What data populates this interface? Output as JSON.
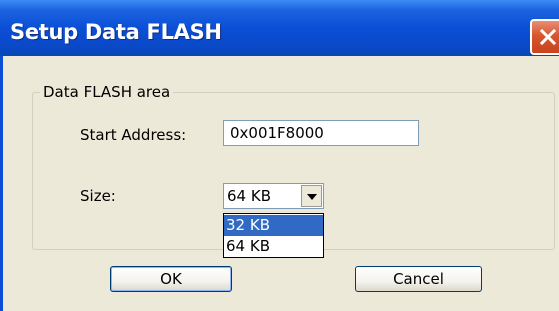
{
  "window": {
    "title": "Setup Data FLASH"
  },
  "group": {
    "label": "Data FLASH area"
  },
  "start_address": {
    "label": "Start Address:",
    "value": "0x001F8000"
  },
  "size": {
    "label": "Size:",
    "selected": "64 KB",
    "options": [
      "32 KB",
      "64 KB"
    ],
    "highlighted": "32 KB"
  },
  "buttons": {
    "ok": "OK",
    "cancel": "Cancel"
  },
  "colors": {
    "titlebar": "#0a4fd6",
    "close_button": "#d6572f",
    "highlight": "#316ac5",
    "dialog_bg": "#ece9d8"
  },
  "icons": {
    "close": "close-icon",
    "dropdown": "chevron-down-icon"
  }
}
